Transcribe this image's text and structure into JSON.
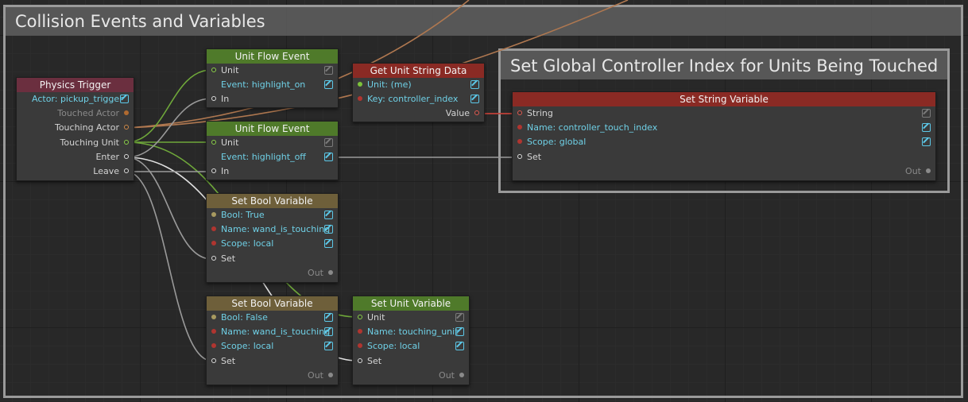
{
  "groups": {
    "main_title": "Collision Events and Variables",
    "sub_title": "Set Global Controller Index for Units Being Touched"
  },
  "nodes": {
    "physics_trigger": {
      "title": "Physics Trigger",
      "actor": "Actor: pickup_trigger",
      "touched_actor": "Touched Actor",
      "touching_actor": "Touching Actor",
      "touching_unit": "Touching Unit",
      "enter": "Enter",
      "leave": "Leave"
    },
    "unit_flow_on": {
      "title": "Unit Flow Event",
      "unit": "Unit",
      "event": "Event: highlight_on",
      "in": "In"
    },
    "unit_flow_off": {
      "title": "Unit Flow Event",
      "unit": "Unit",
      "event": "Event: highlight_off",
      "in": "In"
    },
    "get_unit_string": {
      "title": "Get Unit String Data",
      "unit": "Unit: (me)",
      "key": "Key: controller_index",
      "value": "Value"
    },
    "set_bool_true": {
      "title": "Set Bool Variable",
      "bool": "Bool: True",
      "name": "Name: wand_is_touching",
      "scope": "Scope: local",
      "set": "Set",
      "out": "Out"
    },
    "set_bool_false": {
      "title": "Set Bool Variable",
      "bool": "Bool: False",
      "name": "Name: wand_is_touching",
      "scope": "Scope: local",
      "set": "Set",
      "out": "Out"
    },
    "set_unit_var": {
      "title": "Set Unit Variable",
      "unit": "Unit",
      "name": "Name: touching_unit",
      "scope": "Scope: local",
      "set": "Set",
      "out": "Out"
    },
    "set_string_var": {
      "title": "Set String Variable",
      "string": "String",
      "name": "Name: controller_touch_index",
      "scope": "Scope: global",
      "set": "Set",
      "out": "Out"
    }
  },
  "colors": {
    "flow_wire": "#b8b8b8",
    "unit_wire": "#6fa83a",
    "actor_wire": "#b07850",
    "string_wire": "#c04038"
  }
}
